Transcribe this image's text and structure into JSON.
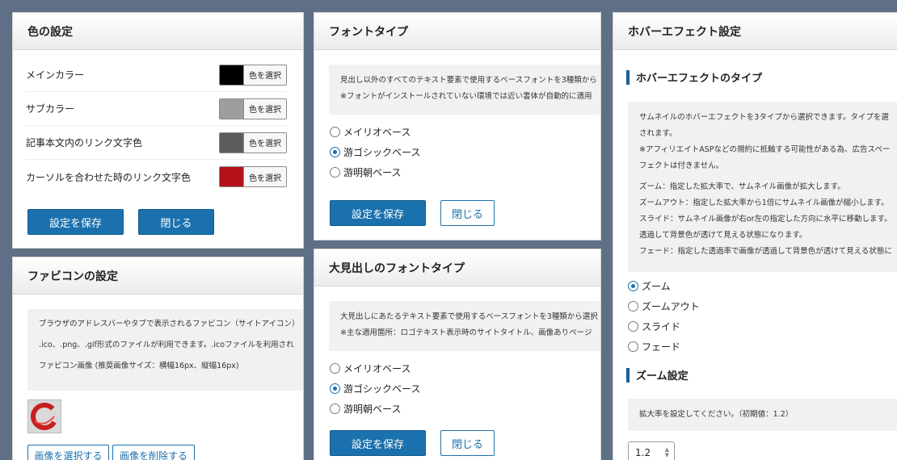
{
  "colors": {
    "accent": "#1b71ad",
    "background": "#5f6f85"
  },
  "color_panel": {
    "title": "色の設定",
    "rows": [
      {
        "label": "メインカラー",
        "swatch": "#000000",
        "button": "色を選択"
      },
      {
        "label": "サブカラー",
        "swatch": "#9e9e9e",
        "button": "色を選択"
      },
      {
        "label": "記事本文内のリンク文字色",
        "swatch": "#5c5c5c",
        "button": "色を選択"
      },
      {
        "label": "カーソルを合わせた時のリンク文字色",
        "swatch": "#b3121a",
        "button": "色を選択"
      }
    ],
    "save": "設定を保存",
    "close": "閉じる"
  },
  "favicon_panel": {
    "title": "ファビコンの設定",
    "desc": [
      "ブラウザのアドレスバーやタブで表示されるファビコン（サイトアイコン）",
      ".ico、.png、.gif形式のファイルが利用できます。.icoファイルを利用され",
      "ファビコン画像 (推奨画像サイズ：横幅16px、縦幅16px)"
    ],
    "select_image": "画像を選択する",
    "delete_image": "画像を削除する"
  },
  "font_panel": {
    "title": "フォントタイプ",
    "desc": [
      "見出し以外のすべてのテキスト要素で使用するベースフォントを3種類から",
      "※フォントがインストールされていない環境では近い書体が自動的に適用"
    ],
    "options": [
      "メイリオベース",
      "游ゴシックベース",
      "游明朝ベース"
    ],
    "selected": 1,
    "save": "設定を保存",
    "close": "閉じる"
  },
  "heading_font_panel": {
    "title": "大見出しのフォントタイプ",
    "desc": [
      "大見出しにあたるテキスト要素で使用するベースフォントを3種類から選択",
      "※主な適用箇所：ロゴテキスト表示時のサイトタイトル、画像ありページ"
    ],
    "options": [
      "メイリオベース",
      "游ゴシックベース",
      "游明朝ベース"
    ],
    "selected": 1,
    "save": "設定を保存",
    "close": "閉じる"
  },
  "hover_panel": {
    "title": "ホバーエフェクト設定",
    "type_heading": "ホバーエフェクトのタイプ",
    "desc": [
      "サムネイルのホバーエフェクトを3タイプから選択できます。タイプを選",
      "されます。",
      "※アフィリエイトASPなどの規約に抵触する可能性がある為、広告スペー",
      "フェクトは付きません。",
      "",
      "ズーム：指定した拡大率で、サムネイル画像が拡大します。",
      "ズームアウト：指定した拡大率から1倍にサムネイル画像が縮小します。",
      "スライド：サムネイル画像が右or左の指定した方向に水平に移動します。",
      "透過して背景色が透けて見える状態になります。",
      "フェード：指定した透過率で画像が透過して背景色が透けて見える状態に"
    ],
    "options": [
      "ズーム",
      "ズームアウト",
      "スライド",
      "フェード"
    ],
    "selected": 0,
    "zoom_heading": "ズーム設定",
    "zoom_desc": "拡大率を設定してください。（初期値：1.2）",
    "zoom_value": "1.2"
  }
}
